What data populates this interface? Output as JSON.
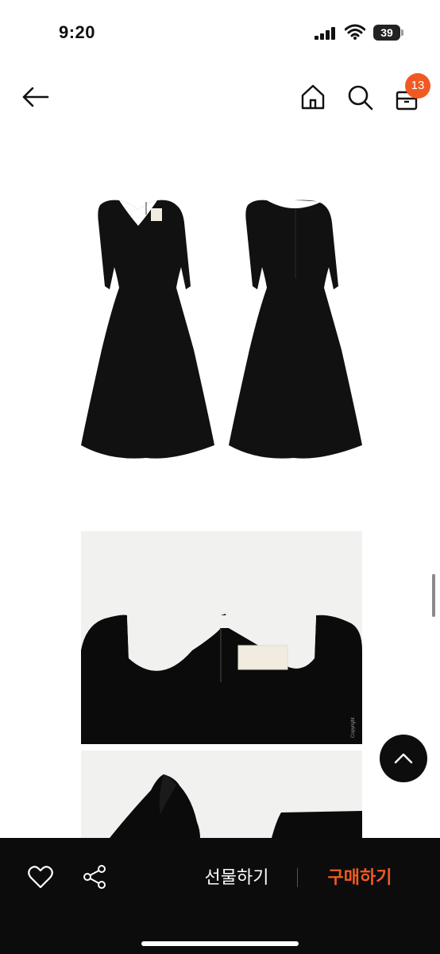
{
  "status_bar": {
    "time": "9:20",
    "battery": "39"
  },
  "nav": {
    "icons": [
      "back-arrow-icon",
      "home-icon",
      "search-icon",
      "shopping-bag-icon"
    ],
    "cart_count": "13"
  },
  "product": {
    "images": [
      "dress-front-back-image",
      "neckline-detail-image",
      "shoulder-detail-image"
    ]
  },
  "bottom_bar": {
    "gift_label": "선물하기",
    "buy_label": "구매하기"
  },
  "colors": {
    "accent": "#f05a22",
    "bar_background": "#0c0c0c",
    "dress": "#111111"
  }
}
